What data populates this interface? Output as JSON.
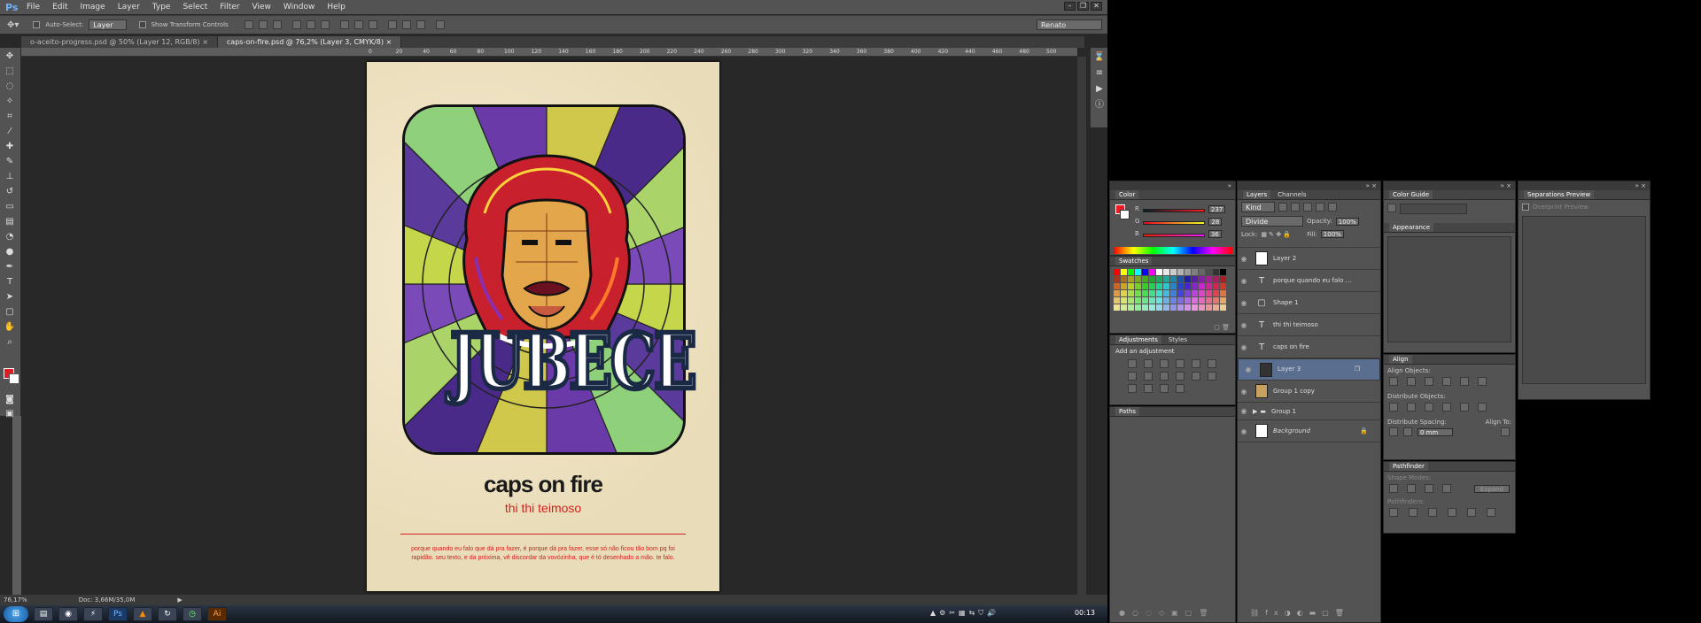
{
  "menubar": {
    "logo": "Ps",
    "items": [
      "File",
      "Edit",
      "Image",
      "Layer",
      "Type",
      "Select",
      "Filter",
      "View",
      "Window",
      "Help"
    ]
  },
  "options": {
    "auto_select": "Auto-Select:",
    "auto_select_target": "Layer",
    "show_transform": "Show Transform Controls",
    "workspace": "Renato"
  },
  "tabs": [
    {
      "label": "o-aceito-progress.psd @ 50% (Layer 12, RGB/8)"
    },
    {
      "label": "caps-on-fire.psd @ 76,2% (Layer 3, CMYK/8)"
    }
  ],
  "ruler_ticks": [
    "0",
    "20",
    "40",
    "60",
    "80",
    "100",
    "120",
    "140",
    "160",
    "180",
    "200",
    "220",
    "240",
    "260",
    "280",
    "300",
    "320",
    "340",
    "360",
    "380",
    "400",
    "420",
    "440",
    "460",
    "480",
    "500"
  ],
  "poster": {
    "headline": "JUBECE",
    "title": "caps on fire",
    "subtitle": "thi thi teimoso",
    "body": "porque quando eu falo que dá pra fazer, é porque dá pra fazer, esse só não ficou tão bom pq foi rapidão. seu texto, e da próxima, vê discordar da vovózinha, que é tó desenhado a mão. te falo."
  },
  "status": {
    "zoom": "76,17%",
    "doc": "Doc: 3,66M/35,0M"
  },
  "color_panel": {
    "title": "Color",
    "r_label": "R",
    "r": "237",
    "g_label": "G",
    "g": "28",
    "b_label": "B",
    "b": "36",
    "fg": "#ed1c24"
  },
  "swatches_panel": {
    "title": "Swatches"
  },
  "adjustments_panel": {
    "tabs": [
      "Adjustments",
      "Styles"
    ],
    "hint": "Add an adjustment"
  },
  "paths_panel": {
    "title": "Paths"
  },
  "layers_panel": {
    "tabs": [
      "Layers",
      "Channels"
    ],
    "filter": "Kind",
    "blend": "Divide",
    "opacity_label": "Opacity:",
    "opacity": "100%",
    "lock_label": "Lock:",
    "fill_label": "Fill:",
    "fill": "100%",
    "layers": [
      {
        "name": "Layer 2",
        "kind": "pixel",
        "selected": false
      },
      {
        "name": "porque quando eu falo ...",
        "kind": "text",
        "selected": false
      },
      {
        "name": "Shape 1",
        "kind": "shape",
        "selected": false
      },
      {
        "name": "thi thi teimoso",
        "kind": "text",
        "selected": false
      },
      {
        "name": "caps on fire",
        "kind": "text",
        "selected": false
      },
      {
        "name": "Layer 3",
        "kind": "pixel",
        "selected": true
      },
      {
        "name": "Group 1 copy",
        "kind": "pixel",
        "selected": false
      },
      {
        "name": "Group 1",
        "kind": "group",
        "selected": false
      },
      {
        "name": "Background",
        "kind": "pixel",
        "selected": false
      }
    ]
  },
  "color_guide_panel": {
    "title": "Color Guide"
  },
  "appearance_panel": {
    "title": "Appearance"
  },
  "align_panel": {
    "title": "Align",
    "align_objects": "Align Objects:",
    "distribute_objects": "Distribute Objects:",
    "distribute_spacing": "Distribute Spacing:",
    "align_to": "Align To:",
    "spacing_value": "0 mm"
  },
  "pathfinder_panel": {
    "title": "Pathfinder",
    "shape_modes": "Shape Modes:",
    "expand": "Expand",
    "pathfinders": "Pathfinders:"
  },
  "separations_panel": {
    "title": "Separations Preview",
    "overprint": "Overprint Preview"
  },
  "taskbar": {
    "clock": "00:13"
  }
}
